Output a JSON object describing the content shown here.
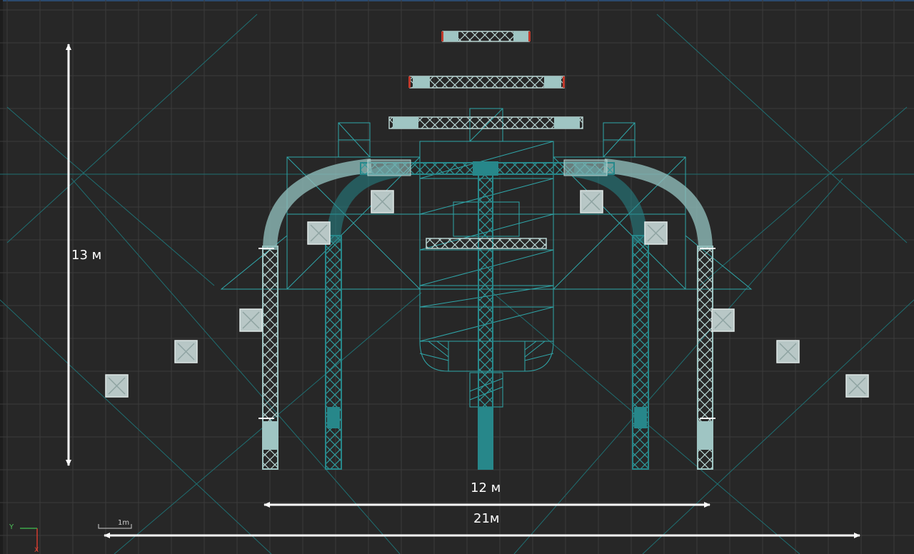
{
  "dimensions": {
    "height_label": "13 м",
    "inner_width_label": "12 м",
    "total_width_label": "21м"
  },
  "scale_bar": {
    "label": "1m"
  },
  "axes": {
    "y_label": "Y",
    "x_label": "X"
  },
  "colors": {
    "background": "#272727",
    "grid": "#3c3c3c",
    "guide": "#1f6f72",
    "truss": "#27878a",
    "truss_light": "#9fc5c3",
    "box": "#b8c7c6",
    "dimension": "#ffffff"
  },
  "objects": {
    "speaker_boxes_count": 12,
    "flown_truss_count": 3
  }
}
